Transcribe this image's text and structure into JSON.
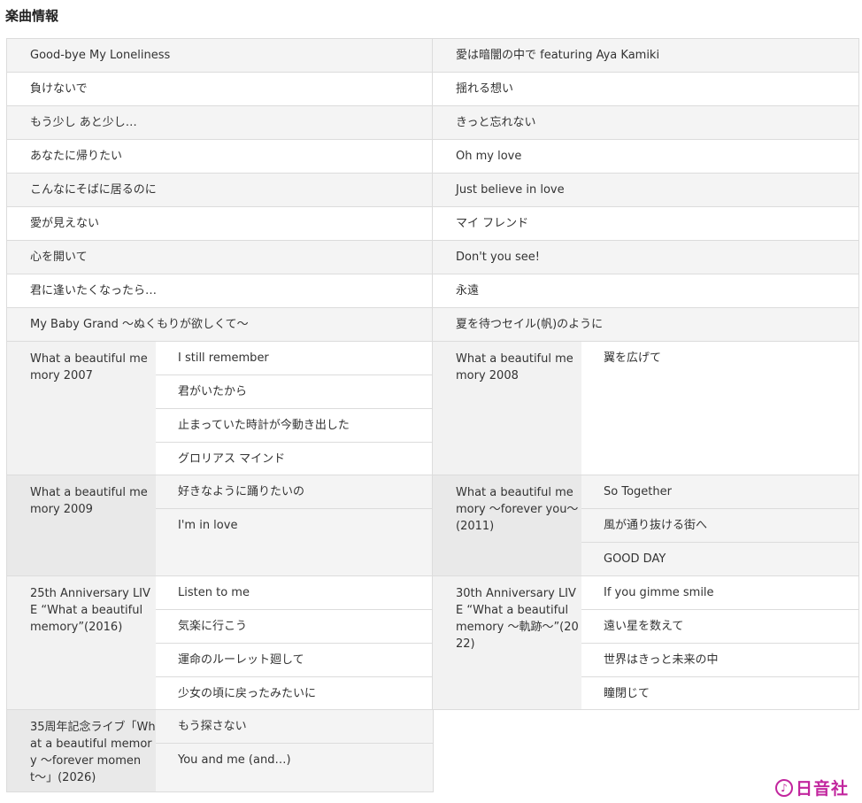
{
  "heading": "楽曲情報",
  "left": {
    "rows": [
      "Good-bye My Loneliness",
      "負けないで",
      "もう少し あと少し…",
      "あなたに帰りたい",
      "こんなにそばに居るのに",
      "愛が見えない",
      "心を開いて",
      "君に逢いたくなったら…",
      "My Baby Grand 〜ぬくもりが欲しくて〜"
    ],
    "groups": [
      {
        "title": "What a beautiful memory 2007",
        "songs": [
          "I still remember",
          "君がいたから",
          "止まっていた時計が今動き出した",
          "グロリアス マインド"
        ]
      },
      {
        "title": "What a beautiful memory 2009",
        "songs": [
          "好きなように踊りたいの",
          "I'm in love"
        ]
      },
      {
        "title": "25th Anniversary LIVE “What a beautiful memory”(2016)",
        "songs": [
          "Listen to me",
          "気楽に行こう",
          "運命のルーレット廻して",
          "少女の頃に戻ったみたいに"
        ]
      },
      {
        "title": "35周年記念ライブ「What a beautiful memory 〜forever moment〜」(2026)",
        "songs": [
          "もう探さない",
          "You and me (and…)"
        ]
      }
    ]
  },
  "right": {
    "rows": [
      "愛は暗闇の中で featuring Aya Kamiki",
      "揺れる想い",
      "きっと忘れない",
      "Oh my love",
      "Just believe in love",
      "マイ フレンド",
      "Don't you see!",
      "永遠",
      "夏を待つセイル(帆)のように"
    ],
    "groups": [
      {
        "title": "What a beautiful memory 2008",
        "songs": [
          "翼を広げて"
        ]
      },
      {
        "title": "What a beautiful memory 〜forever you〜(2011)",
        "songs": [
          "So Together",
          "風が通り抜ける街へ",
          "GOOD DAY"
        ]
      },
      {
        "title": "30th Anniversary LIVE “What a beautiful memory 〜軌跡〜”(2022)",
        "songs": [
          "If you gimme smile",
          "遠い星を数えて",
          "世界はきっと未来の中",
          "瞳閉じて"
        ]
      }
    ]
  },
  "logo": {
    "icon": "music-note-icon",
    "text": "日音社"
  }
}
